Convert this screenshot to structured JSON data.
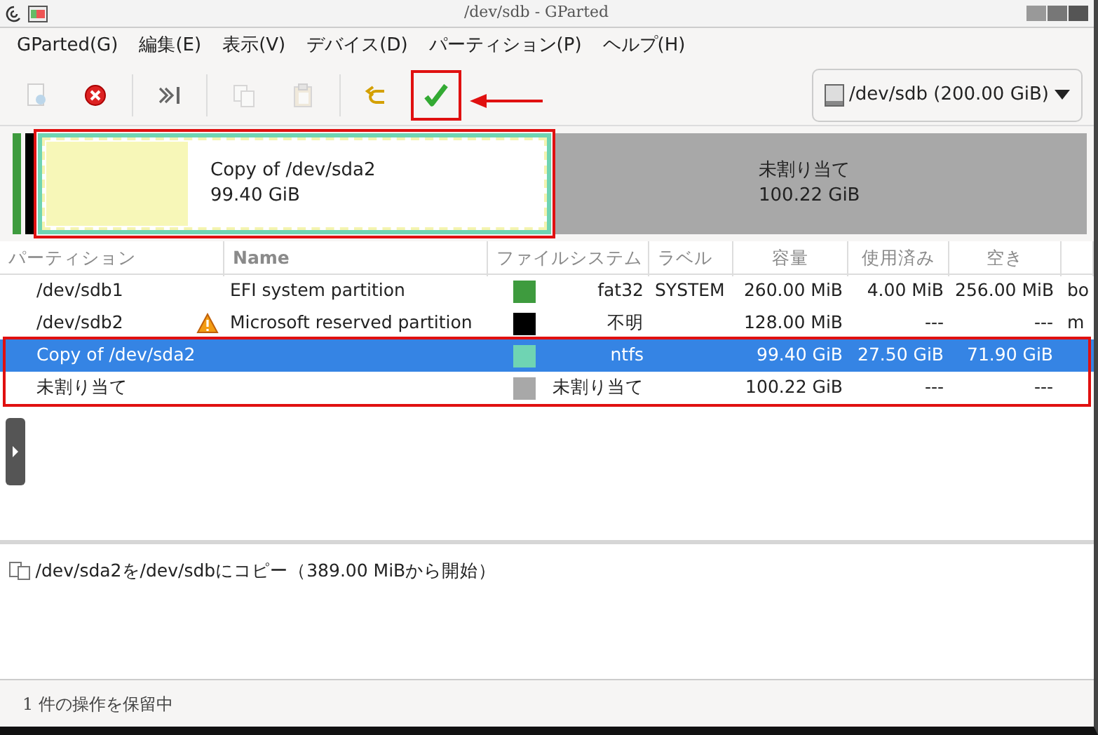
{
  "window": {
    "title": "/dev/sdb - GParted"
  },
  "menu": [
    "GParted(G)",
    "編集(E)",
    "表示(V)",
    "デバイス(D)",
    "パーティション(P)",
    "ヘルプ(H)"
  ],
  "toolbar": [
    {
      "kind": "new",
      "disabled": true
    },
    {
      "kind": "delete",
      "disabled": false
    },
    {
      "kind": "sep"
    },
    {
      "kind": "resize",
      "disabled": false
    },
    {
      "kind": "sep"
    },
    {
      "kind": "copy",
      "disabled": true
    },
    {
      "kind": "paste",
      "disabled": true
    },
    {
      "kind": "sep"
    },
    {
      "kind": "undo",
      "disabled": false
    },
    {
      "kind": "apply",
      "disabled": false
    }
  ],
  "device_selector": {
    "value": "/dev/sdb (200.00 GiB)"
  },
  "disk_map": [
    {
      "kind": "partition",
      "color": "#3e9b3e",
      "selected": false
    },
    {
      "kind": "partition",
      "color": "#000000",
      "selected": false
    },
    {
      "kind": "partition",
      "color": "#6fd4b3",
      "selected": true,
      "name": "Copy of /dev/sda2",
      "size": "99.40 GiB",
      "level": 0.28
    },
    {
      "kind": "unallocated",
      "color": "#a8a8a8",
      "selected": false,
      "name": "未割り当て",
      "size": "100.22 GiB"
    }
  ],
  "table": {
    "columns": [
      "パーティション",
      "Name",
      "ファイルシステム",
      "ラベル",
      "容量",
      "使用済み",
      "空き"
    ],
    "rows": [
      {
        "partition": "/dev/sdb1",
        "warning": false,
        "name": "EFI system partition",
        "color": "#3e9b3e",
        "filesystem": "fat32",
        "label": "SYSTEM",
        "size": "260.00 MiB",
        "used": "4.00 MiB",
        "free": "256.00 MiB",
        "column_8": "bo",
        "selected": false
      },
      {
        "partition": "/dev/sdb2",
        "warning": true,
        "name": "Microsoft reserved partition",
        "color": "#000000",
        "filesystem": "不明",
        "size": "128.00 MiB",
        "used": "---",
        "free": "---",
        "column_8": "m",
        "selected": false
      },
      {
        "partition": "Copy of /dev/sda2",
        "warning": false,
        "color": "#6fd4b3",
        "filesystem": "ntfs",
        "size": "99.40 GiB",
        "used": "27.50 GiB",
        "free": "71.90 GiB",
        "selected": true
      },
      {
        "partition": "未割り当て",
        "warning": false,
        "color": "#a8a8a8",
        "filesystem": "未割り当て",
        "size": "100.22 GiB",
        "used": "---",
        "free": "---",
        "selected": false
      }
    ]
  },
  "operations": [
    "/dev/sda2を/dev/sdbにコピー（389.00 MiBから開始）"
  ],
  "status_bar": "1 件の操作を保留中"
}
